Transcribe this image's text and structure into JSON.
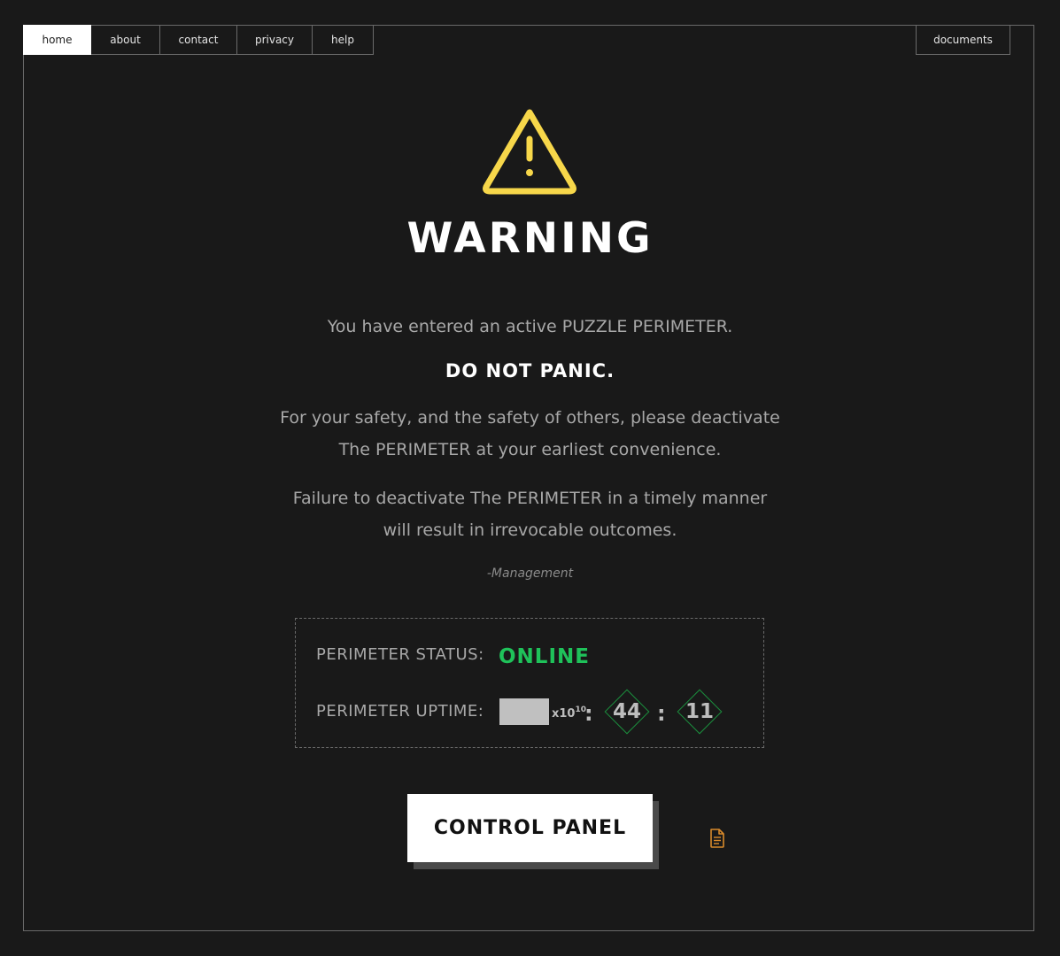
{
  "nav": {
    "items": [
      {
        "label": "home",
        "active": true
      },
      {
        "label": "about"
      },
      {
        "label": "contact"
      },
      {
        "label": "privacy"
      },
      {
        "label": "help"
      }
    ],
    "documents": "documents"
  },
  "warning": {
    "icon": "warning-triangle-icon",
    "icon_color": "#f7d74a",
    "title": "WARNING"
  },
  "message": {
    "line1": "You have entered an active PUZZLE PERIMETER.",
    "panic": "DO NOT PANIC.",
    "safety_1": "For your safety, and the safety of others, please deactivate",
    "safety_2": "The PERIMETER at your earliest convenience.",
    "failure_1": "Failure to deactivate The PERIMETER in a timely manner",
    "failure_2": "will result in irrevocable outcomes.",
    "signature": "-Management"
  },
  "status": {
    "status_label": "PERIMETER STATUS:",
    "status_value": "ONLINE",
    "status_color": "#1fc25a",
    "uptime_label": "PERIMETER UPTIME:",
    "uptime_exponent_base": "x10",
    "uptime_exponent_power": "10",
    "uptime_minutes": "44",
    "uptime_seconds": "11"
  },
  "control_panel": {
    "label": "CONTROL PANEL"
  },
  "document_icon": "document-icon"
}
